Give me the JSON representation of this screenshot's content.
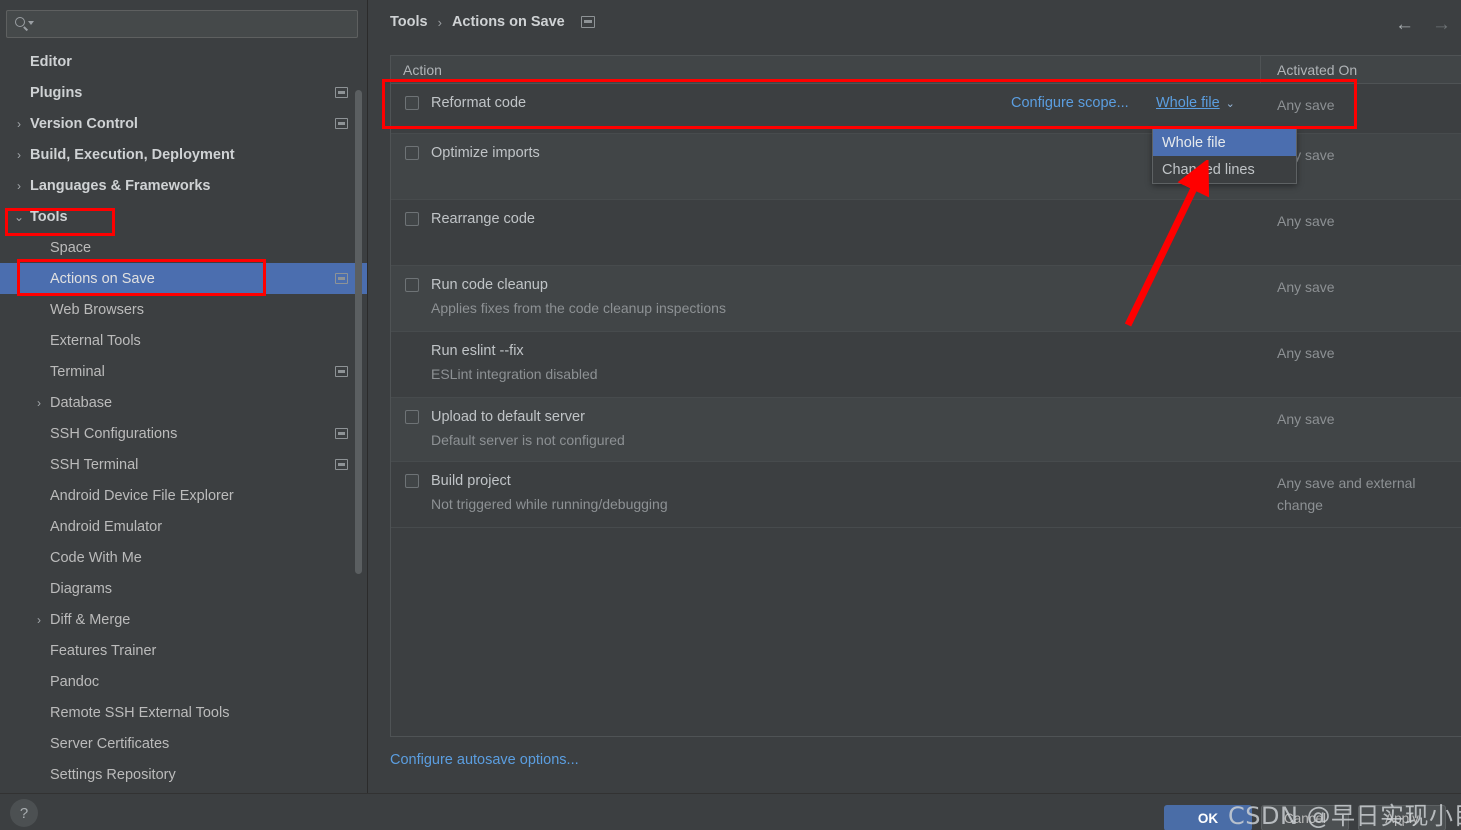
{
  "search": {
    "placeholder": "",
    "value": "",
    "icon": "search-icon"
  },
  "sidebar": {
    "items": [
      {
        "label": "Editor",
        "indent": 0,
        "arrow": "",
        "bold": true,
        "tag": false,
        "selected": false
      },
      {
        "label": "Plugins",
        "indent": 0,
        "arrow": "",
        "bold": true,
        "tag": true,
        "selected": false
      },
      {
        "label": "Version Control",
        "indent": 0,
        "arrow": "›",
        "bold": true,
        "tag": true,
        "selected": false
      },
      {
        "label": "Build, Execution, Deployment",
        "indent": 0,
        "arrow": "›",
        "bold": true,
        "tag": false,
        "selected": false
      },
      {
        "label": "Languages & Frameworks",
        "indent": 0,
        "arrow": "›",
        "bold": true,
        "tag": false,
        "selected": false
      },
      {
        "label": "Tools",
        "indent": 0,
        "arrow": "⌄",
        "bold": true,
        "tag": false,
        "selected": false
      },
      {
        "label": "Space",
        "indent": 1,
        "arrow": "",
        "bold": false,
        "tag": false,
        "selected": false
      },
      {
        "label": "Actions on Save",
        "indent": 1,
        "arrow": "",
        "bold": false,
        "tag": true,
        "selected": true
      },
      {
        "label": "Web Browsers",
        "indent": 1,
        "arrow": "",
        "bold": false,
        "tag": false,
        "selected": false
      },
      {
        "label": "External Tools",
        "indent": 1,
        "arrow": "",
        "bold": false,
        "tag": false,
        "selected": false
      },
      {
        "label": "Terminal",
        "indent": 1,
        "arrow": "",
        "bold": false,
        "tag": true,
        "selected": false
      },
      {
        "label": "Database",
        "indent": 1,
        "arrow": "›",
        "bold": false,
        "tag": false,
        "selected": false
      },
      {
        "label": "SSH Configurations",
        "indent": 1,
        "arrow": "",
        "bold": false,
        "tag": true,
        "selected": false
      },
      {
        "label": "SSH Terminal",
        "indent": 1,
        "arrow": "",
        "bold": false,
        "tag": true,
        "selected": false
      },
      {
        "label": "Android Device File Explorer",
        "indent": 1,
        "arrow": "",
        "bold": false,
        "tag": false,
        "selected": false
      },
      {
        "label": "Android Emulator",
        "indent": 1,
        "arrow": "",
        "bold": false,
        "tag": false,
        "selected": false
      },
      {
        "label": "Code With Me",
        "indent": 1,
        "arrow": "",
        "bold": false,
        "tag": false,
        "selected": false
      },
      {
        "label": "Diagrams",
        "indent": 1,
        "arrow": "",
        "bold": false,
        "tag": false,
        "selected": false
      },
      {
        "label": "Diff & Merge",
        "indent": 1,
        "arrow": "›",
        "bold": false,
        "tag": false,
        "selected": false
      },
      {
        "label": "Features Trainer",
        "indent": 1,
        "arrow": "",
        "bold": false,
        "tag": false,
        "selected": false
      },
      {
        "label": "Pandoc",
        "indent": 1,
        "arrow": "",
        "bold": false,
        "tag": false,
        "selected": false
      },
      {
        "label": "Remote SSH External Tools",
        "indent": 1,
        "arrow": "",
        "bold": false,
        "tag": false,
        "selected": false
      },
      {
        "label": "Server Certificates",
        "indent": 1,
        "arrow": "",
        "bold": false,
        "tag": false,
        "selected": false
      },
      {
        "label": "Settings Repository",
        "indent": 1,
        "arrow": "",
        "bold": false,
        "tag": false,
        "selected": false
      }
    ]
  },
  "header": {
    "breadcrumb_root": "Tools",
    "breadcrumb_sep": "›",
    "breadcrumb_current": "Actions on Save",
    "back_arrow": "←",
    "forward_arrow": "→"
  },
  "table": {
    "col_action": "Action",
    "col_activated": "Activated On",
    "rows": [
      {
        "title": "Reformat code",
        "sub": "",
        "activated": "Any save",
        "checkbox": true
      },
      {
        "title": "Optimize imports",
        "sub": "",
        "activated": "Any save",
        "checkbox": true
      },
      {
        "title": "Rearrange code",
        "sub": "",
        "activated": "Any save",
        "checkbox": true
      },
      {
        "title": "Run code cleanup",
        "sub": "Applies fixes from the code cleanup inspections",
        "activated": "Any save",
        "checkbox": true
      },
      {
        "title": "Run eslint --fix",
        "sub": "ESLint integration disabled",
        "activated": "Any save",
        "checkbox": false
      },
      {
        "title": "Upload to default server",
        "sub": "Default server is not configured",
        "activated": "Any save",
        "checkbox": true
      },
      {
        "title": "Build project",
        "sub": "Not triggered while running/debugging",
        "activated": "Any save and external change",
        "checkbox": true
      }
    ],
    "configure_scope_link": "Configure scope...",
    "scope_value": "Whole file",
    "scope_chevron": "⌄"
  },
  "dropdown": {
    "options": [
      {
        "label": "Whole file",
        "selected": true
      },
      {
        "label": "Changed lines",
        "selected": false
      }
    ]
  },
  "footer": {
    "configure_autosave": "Configure autosave options...",
    "help": "?",
    "ok": "OK",
    "cancel": "Cancel",
    "apply": "Apply",
    "watermark": "CSDN @早日实现小目标"
  },
  "colors": {
    "accent_blue": "#4b6eaf",
    "link_blue": "#5b9ee0",
    "annotation_red": "#ff0000",
    "panel_bg": "#3c3f41"
  }
}
